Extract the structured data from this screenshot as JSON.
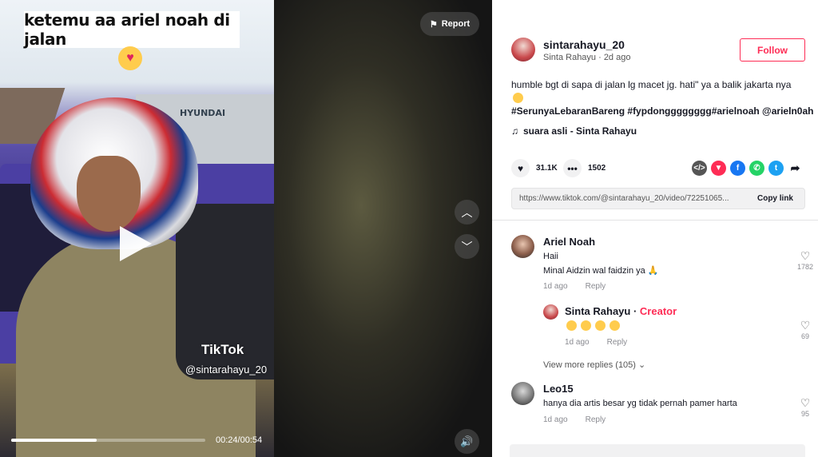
{
  "video": {
    "caption": "ketemu aa ariel noah di jalan",
    "building_sign": "HYUNDAI",
    "watermark_logo": "TikTok",
    "watermark_user": "@sintarahayu_20",
    "time": "00:24/00:54",
    "progress": 0.44,
    "report_label": "Report"
  },
  "post": {
    "username": "sintarahayu_20",
    "nickname": "Sinta Rahayu · 2d ago",
    "follow_label": "Follow",
    "description": "humble bgt di sapa di jalan lg macet jg. hati\" ya a balik jakarta nya",
    "hashtags": "#SerunyaLebaranBareng #fypdongggggggg#arielnoah @arieln0ah",
    "music": "suara asli - Sinta Rahayu",
    "likes": "31.1K",
    "comments_count": "1502",
    "link": "https://www.tiktok.com/@sintarahayu_20/video/72251065...",
    "copy_link_label": "Copy link"
  },
  "comments": [
    {
      "name": "Ariel Noah",
      "line1": "Haii",
      "line2": "Minal Aidzin wal faidzin ya",
      "time": "1d ago",
      "reply": "Reply",
      "likes": "1782"
    },
    {
      "name": "Sinta Rahayu · ",
      "badge": "Creator",
      "time": "1d ago",
      "reply": "Reply",
      "likes": "69"
    },
    {
      "name": "Leo15",
      "line1": "hanya dia artis besar yg tidak pernah pamer harta",
      "time": "1d ago",
      "reply": "Reply",
      "likes": "95"
    }
  ],
  "view_more": "View more replies (105)",
  "icons": [
    "flag-icon",
    "chevron-up-icon",
    "chevron-down-icon",
    "volume-icon",
    "heart-icon",
    "comment-icon",
    "embed-icon",
    "share-icon",
    "music-note-icon"
  ]
}
